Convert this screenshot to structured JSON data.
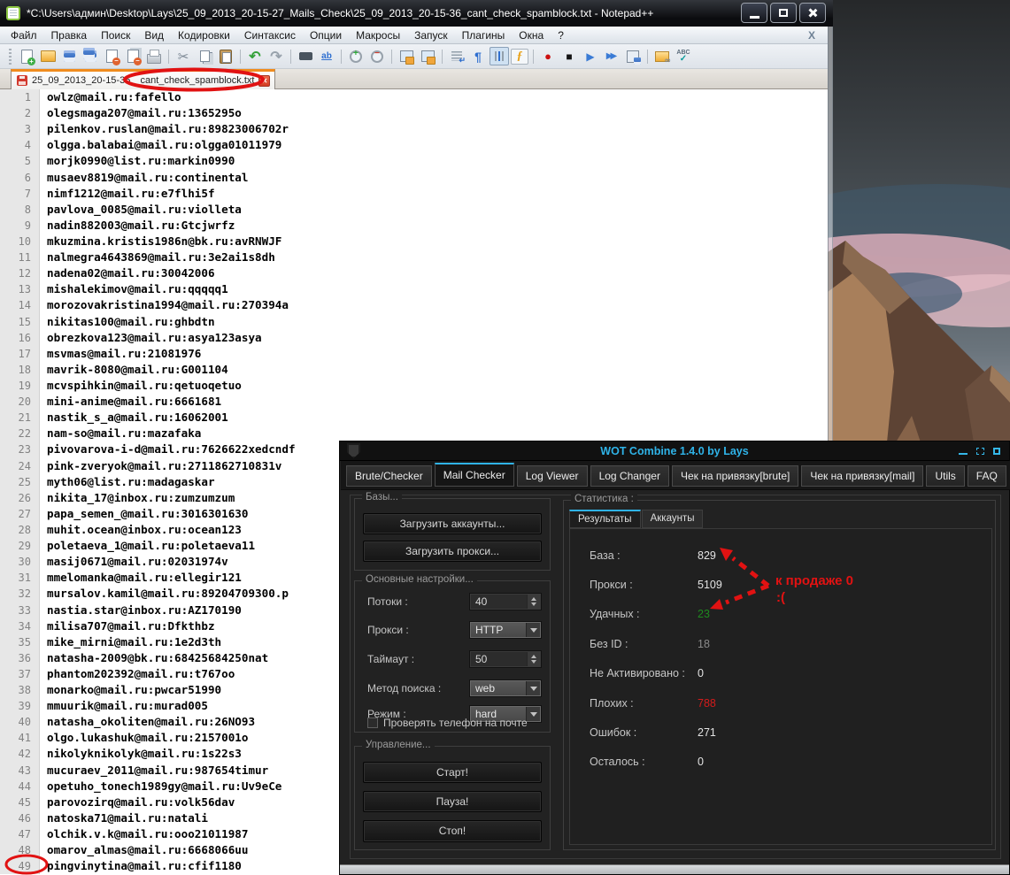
{
  "notepad": {
    "title": "*C:\\Users\\админ\\Desktop\\Lays\\25_09_2013_20-15-27_Mails_Check\\25_09_2013_20-15-36_cant_check_spamblock.txt - Notepad++",
    "menu": [
      "Файл",
      "Правка",
      "Поиск",
      "Вид",
      "Кодировки",
      "Синтаксис",
      "Опции",
      "Макросы",
      "Запуск",
      "Плагины",
      "Окна",
      "?"
    ],
    "menu_close": "X",
    "tab": {
      "prefix": "25_09_2013_20-15-36_",
      "circled": "cant_check_spamblock.txt"
    },
    "toolbar": [
      {
        "n": "new-file-icon",
        "c": "i-new"
      },
      {
        "n": "open-folder-icon",
        "c": "i-open"
      },
      {
        "n": "save-icon",
        "c": "i-save"
      },
      {
        "n": "save-all-icon",
        "c": "i-saveall"
      },
      {
        "n": "close-file-icon",
        "c": "i-close1"
      },
      {
        "n": "close-all-icon",
        "c": "i-closeall"
      },
      {
        "n": "print-icon",
        "c": "i-print"
      },
      {
        "c": "sep",
        "f": false
      },
      {
        "n": "cut-icon",
        "c": "i-cut",
        "g": "✂"
      },
      {
        "n": "copy-icon",
        "c": "i-copy"
      },
      {
        "n": "paste-icon",
        "c": "i-paste"
      },
      {
        "c": "sep",
        "f": false
      },
      {
        "n": "undo-icon",
        "c": "i-undo",
        "g": "↶"
      },
      {
        "n": "redo-icon",
        "c": "i-redo",
        "g": "↷"
      },
      {
        "c": "sep",
        "f": false
      },
      {
        "n": "find-icon",
        "c": "i-find"
      },
      {
        "n": "replace-icon",
        "c": "i-replace",
        "g": "ab"
      },
      {
        "c": "sep",
        "f": false
      },
      {
        "n": "zoom-in-icon",
        "c": "i-zin"
      },
      {
        "n": "zoom-out-icon",
        "c": "i-zout"
      },
      {
        "c": "sep",
        "f": false
      },
      {
        "n": "sync-scroll-v-icon",
        "c": "i-sync"
      },
      {
        "n": "sync-scroll-h-icon",
        "c": "i-sync"
      },
      {
        "c": "sep",
        "f": false
      },
      {
        "n": "word-wrap-icon",
        "c": "i-wrap"
      },
      {
        "n": "show-symbols-icon",
        "c": "i-pilcrow",
        "g": "¶"
      },
      {
        "n": "indent-guide-icon",
        "c": "i-indent pressed"
      },
      {
        "n": "function-list-icon",
        "c": "i-func",
        "g": "ƒ"
      },
      {
        "c": "sep",
        "f": false
      },
      {
        "n": "record-macro-icon",
        "c": "i-rec",
        "g": "●"
      },
      {
        "n": "stop-macro-icon",
        "c": "i-stopm",
        "g": "■"
      },
      {
        "n": "play-macro-icon",
        "c": "i-play",
        "g": "▶"
      },
      {
        "n": "run-macro-multi-icon",
        "c": "i-playm",
        "g": "▶▶"
      },
      {
        "n": "save-macro-icon",
        "c": "i-savem"
      },
      {
        "c": "sep",
        "f": false
      },
      {
        "n": "plugins-icon",
        "c": "i-plugin"
      },
      {
        "n": "spellcheck-icon",
        "c": "i-abc",
        "g": "ABC"
      }
    ],
    "lines": [
      "owlz@mail.ru:fafello",
      "olegsmaga207@mail.ru:1365295o",
      "pilenkov.ruslan@mail.ru:89823006702r",
      "olgga.balabai@mail.ru:olgga01011979",
      "morjk0990@list.ru:markin0990",
      "musaev8819@mail.ru:continental",
      "nimf1212@mail.ru:e7flhi5f",
      "pavlova_0085@mail.ru:violleta",
      "nadin882003@mail.ru:Gtcjwrfz",
      "mkuzmina.kristis1986n@bk.ru:avRNWJF",
      "nalmegra4643869@mail.ru:3e2ai1s8dh",
      "nadena02@mail.ru:30042006",
      "mishalekimov@mail.ru:qqqqq1",
      "morozovakristina1994@mail.ru:270394a",
      "nikitas100@mail.ru:ghbdtn",
      "obrezkova123@mail.ru:asya123asya",
      "msvmas@mail.ru:21081976",
      "mavrik-8080@mail.ru:G001104",
      "mcvspihkin@mail.ru:qetuoqetuo",
      "mini-anime@mail.ru:6661681",
      "nastik_s_a@mail.ru:16062001",
      "nam-so@mail.ru:mazafaka",
      "pivovarova-i-d@mail.ru:7626622xedcndf",
      "pink-zveryok@mail.ru:2711862710831v",
      "myth06@list.ru:madagaskar",
      "nikita_17@inbox.ru:zumzumzum",
      "papa_semen_@mail.ru:3016301630",
      "muhit.ocean@inbox.ru:ocean123",
      "poletaeva_1@mail.ru:poletaeva11",
      "masij0671@mail.ru:02031974v",
      "mmelomanka@mail.ru:ellegir121",
      "mursalov.kamil@mail.ru:89204709300.p",
      "nastia.star@inbox.ru:AZ170190",
      "milisa707@mail.ru:Dfkthbz",
      "mike_mirni@mail.ru:1e2d3th",
      "natasha-2009@bk.ru:68425684250nat",
      "phantom202392@mail.ru:t767oo",
      "monarko@mail.ru:pwcar51990",
      "mmuurik@mail.ru:murad005",
      "natasha_okoliten@mail.ru:26NO93",
      "olgo.lukashuk@mail.ru:2157001o",
      "nikolyknikolyk@mail.ru:1s22s3",
      "mucuraev_2011@mail.ru:987654timur",
      "opetuho_tonech1989gy@mail.ru:Uv9eCe",
      "parovozirq@mail.ru:volk56dav",
      "natoska71@mail.ru:natali",
      "olchik.v.k@mail.ru:ooo21011987",
      "omarov_almas@mail.ru:6668066uu",
      "pingvinytina@mail.ru:cfif1180"
    ]
  },
  "wot": {
    "title": "WOT Combine 1.4.0 by Lays",
    "tabs": [
      {
        "label": "Brute/Checker"
      },
      {
        "label": "Mail Checker",
        "active": true
      },
      {
        "label": "Log Viewer"
      },
      {
        "label": "Log Changer"
      },
      {
        "label": "Чек на привязку[brute]"
      },
      {
        "label": "Чек на привязку[mail]"
      },
      {
        "label": "Utils"
      },
      {
        "label": "FAQ"
      }
    ],
    "left": {
      "group_bases": "Базы...",
      "btn_accounts": "Загрузить аккаунты...",
      "btn_proxy": "Загрузить прокси...",
      "group_settings": "Основные настройки...",
      "lbl_threads": "Потоки :",
      "threads": "40",
      "lbl_proxy": "Прокси :",
      "proxy_type": "HTTP",
      "lbl_timeout": "Таймаут :",
      "timeout": "50",
      "lbl_method": "Метод поиска :",
      "method": "web",
      "lbl_mode": "Режим :",
      "mode": "hard",
      "chk_phone": "Проверять телефон на почте",
      "group_control": "Управление...",
      "btn_start": "Старт!",
      "btn_pause": "Пауза!",
      "btn_stop": "Стоп!"
    },
    "stats": {
      "group": "Статистика :",
      "tab_results": "Результаты",
      "tab_accounts": "Аккаунты",
      "rows": [
        {
          "label": "База :",
          "value": "829"
        },
        {
          "label": "Прокси :",
          "value": "5109"
        },
        {
          "label": "Удачных :",
          "value": "23",
          "cls": "green"
        },
        {
          "label": "Без ID :",
          "value": "18",
          "cls": "dim"
        },
        {
          "label": "Не Активировано :",
          "value": "0"
        },
        {
          "label": "Плохих :",
          "value": "788",
          "cls": "red"
        },
        {
          "label": "Ошибок :",
          "value": "271"
        },
        {
          "label": "Осталось :",
          "value": "0"
        }
      ]
    }
  },
  "annotation": {
    "note1": "к продаже 0",
    "note2": ":(",
    "color": "#e11212"
  },
  "colors": {
    "wot_accent": "#2fb3e8",
    "tab_active_stripe": "#f08c1e",
    "good_green": "#1f8a1f",
    "bad_red": "#d31b1b"
  }
}
